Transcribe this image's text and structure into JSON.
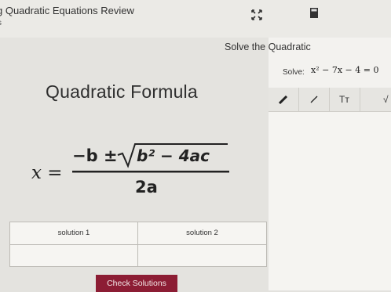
{
  "header": {
    "title": "g Quadratic Equations Review",
    "subtitle": "s",
    "expand_icon": "expand-icon",
    "calculator_icon": "calculator-icon"
  },
  "left_panel": {
    "formula_heading": "Quadratic Formula",
    "formula": {
      "lhs": "x =",
      "numerator_prefix": "−b ±",
      "radicand": "b² − 4ac",
      "denominator": "2a"
    },
    "solutions_table": {
      "headers": [
        "solution 1",
        "solution 2"
      ],
      "values": [
        "",
        ""
      ]
    },
    "check_button_label": "Check Solutions",
    "accent_color": "#8c1d34"
  },
  "right_panel": {
    "heading": "Solve the Quadratic",
    "solve_label": "Solve:",
    "equation": "x² − 7x − 4 = 0",
    "toolbar": {
      "tools": [
        "pen-icon",
        "line-icon"
      ],
      "text_tool_label": "Tт",
      "sqrt_tool_label": "√"
    }
  }
}
